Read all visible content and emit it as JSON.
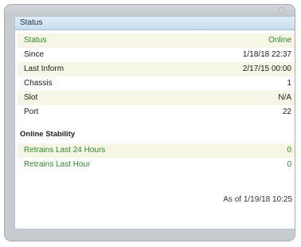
{
  "panel": {
    "title": "Status"
  },
  "status_rows": [
    {
      "label": "Status",
      "value": "Online"
    },
    {
      "label": "Since",
      "value": "1/18/18 22:37"
    },
    {
      "label": "Last Inform",
      "value": "2/17/15 00:00"
    },
    {
      "label": "Chassis",
      "value": "1"
    },
    {
      "label": "Slot",
      "value": "N/A"
    },
    {
      "label": "Port",
      "value": "22"
    }
  ],
  "stability": {
    "heading": "Online Stability",
    "rows": [
      {
        "label": "Retrains Last 24 Hours",
        "value": "0"
      },
      {
        "label": "Retrains Last Hour",
        "value": "0"
      }
    ]
  },
  "footer": {
    "as_of": "As of 1/19/18 10:25"
  },
  "colors": {
    "green_text": "#2f8a2a",
    "shade_row": "#f6f6e6",
    "header_bg": "#c9dcee"
  }
}
